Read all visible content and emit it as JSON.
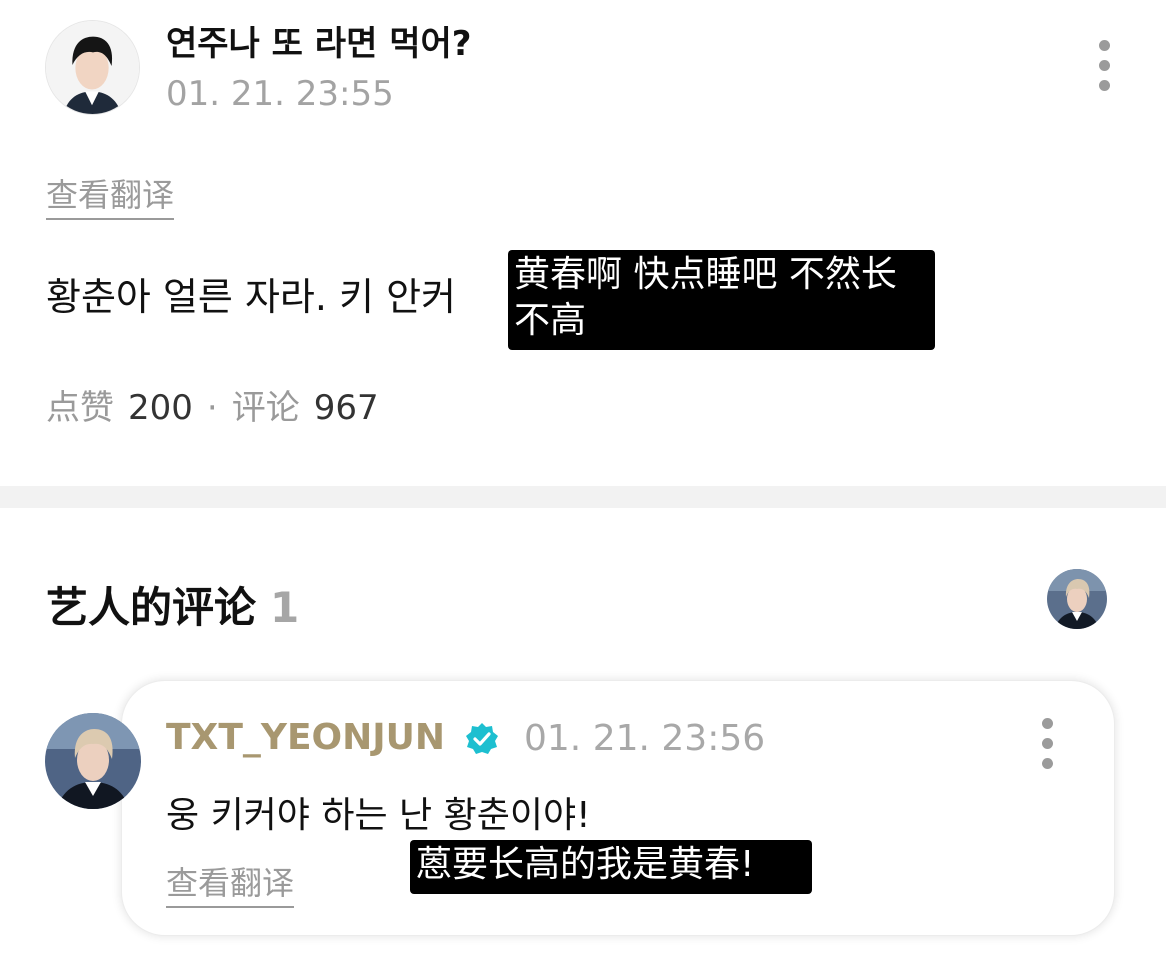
{
  "post": {
    "title": "연주나 또 라면 먹어?",
    "time": "01. 21. 23:55",
    "translate_label": "查看翻译",
    "body": "황춘아 얼른 자라. 키 안커",
    "caption": "黄春啊 快点睡吧 不然长不高",
    "stats": {
      "likes_label": "点赞",
      "likes_count": "200",
      "separator": "·",
      "comments_label": "评论",
      "comments_count": "967"
    }
  },
  "artist_comments": {
    "title": "艺人的评论",
    "count": "1"
  },
  "comment": {
    "author": "TXT_YEONJUN",
    "time": "01. 21. 23:56",
    "body": "웅 키커야 하는 난 황춘이야!",
    "translate_label": "查看翻译",
    "caption": "蒽要长高的我是黄春!"
  },
  "icons": {
    "more": "more-vertical-icon",
    "verified": "verified-badge-icon"
  },
  "colors": {
    "author": "#a89770",
    "verified": "#1dbfd0",
    "muted": "#9a9a9a",
    "caption_bg": "#000000"
  }
}
